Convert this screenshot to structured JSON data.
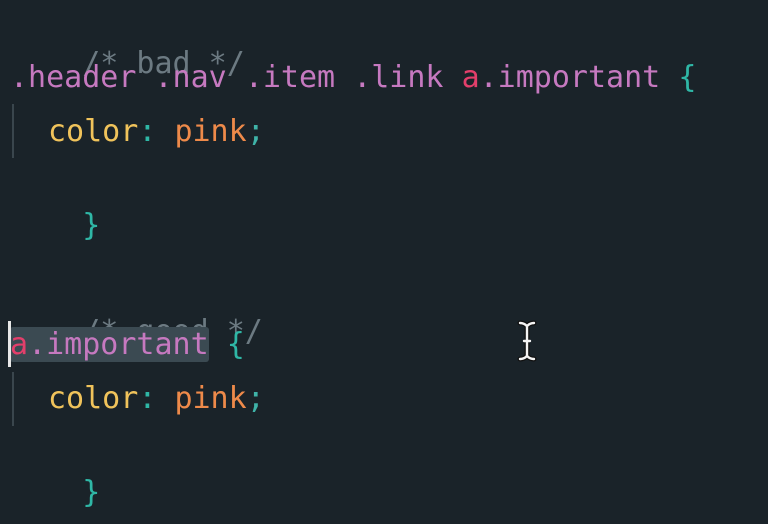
{
  "code": {
    "comment_bad": "/* bad */",
    "sel1": {
      "p1": ".header",
      "p2": " ",
      "p3": ".nav",
      "p4": " ",
      "p5": ".item",
      "p6": " ",
      "p7": ".link",
      "p8": " ",
      "tag": "a",
      "cls": ".important",
      "sp": " ",
      "open": "{"
    },
    "decl1": {
      "prop": "color",
      "colon": ":",
      "sp": " ",
      "value": "pink",
      "semi": ";"
    },
    "close1": "}",
    "comment_good": "/* good */",
    "sel2": {
      "tag": "a",
      "cls": ".important",
      "sp": " ",
      "open": "{"
    },
    "decl2": {
      "prop": "color",
      "colon": ":",
      "sp": " ",
      "value": "pink",
      "semi": ";"
    },
    "close2": "}"
  },
  "cursor": {
    "icon": "text-cursor-ibeam-icon"
  }
}
